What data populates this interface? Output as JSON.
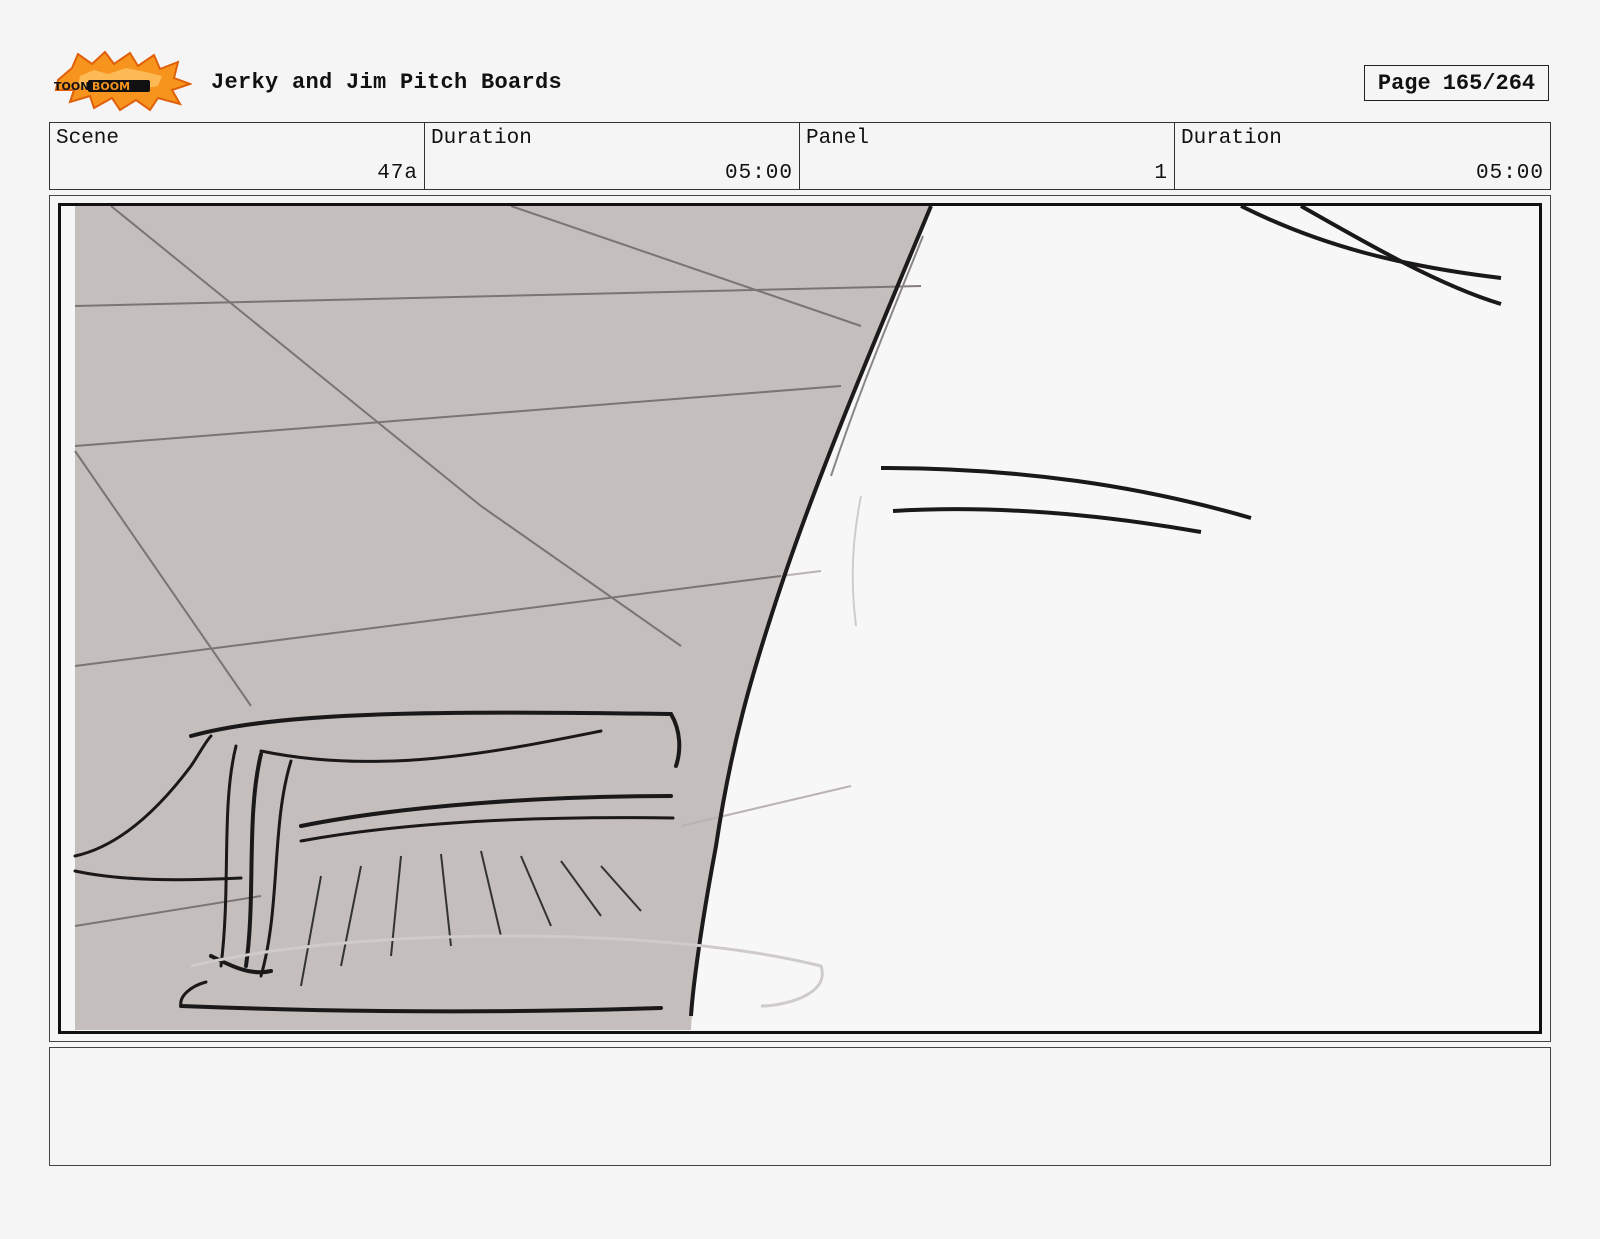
{
  "header": {
    "logo_text": "TOONBOOM",
    "title": "Jerky and Jim Pitch Boards",
    "page_label": "Page",
    "page_value": "165/264"
  },
  "info": {
    "scene_label": "Scene",
    "scene_value": "47a",
    "scene_duration_label": "Duration",
    "scene_duration_value": "05:00",
    "panel_label": "Panel",
    "panel_value": "1",
    "panel_duration_label": "Duration",
    "panel_duration_value": "05:00"
  },
  "notes": {
    "text": ""
  }
}
